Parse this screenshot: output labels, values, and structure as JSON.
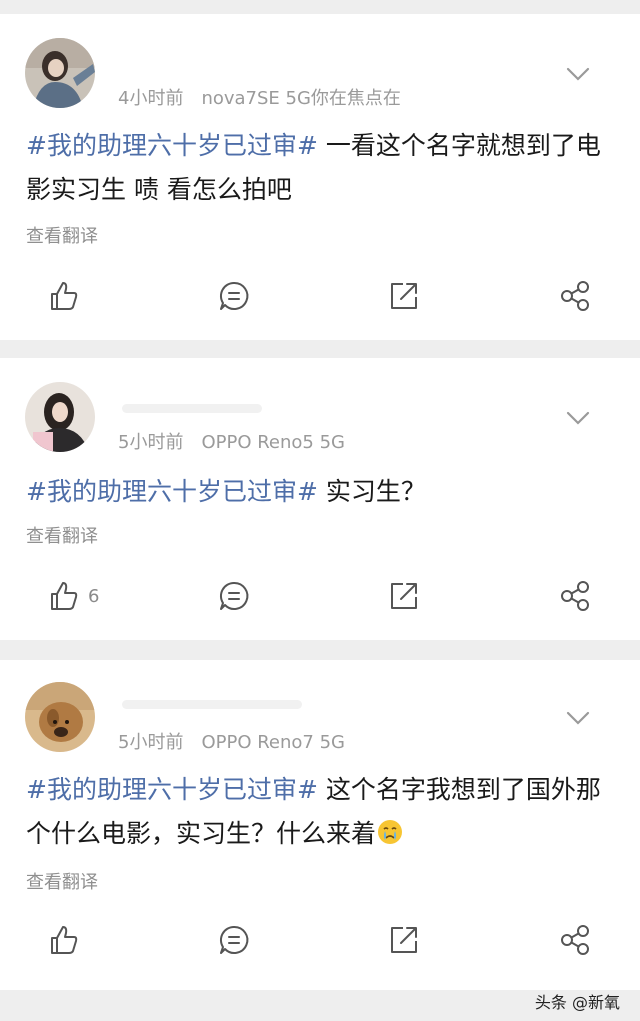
{
  "posts": [
    {
      "time": "4小时前",
      "source": "nova7SE 5G你在焦点在",
      "hashtag": "#我的助理六十岁已过审#",
      "body": " 一看这个名字就想到了电影实习生 啧 看怎么拍吧",
      "translate": "查看翻译",
      "likes": ""
    },
    {
      "time": "5小时前",
      "source": "OPPO Reno5 5G",
      "hashtag": "#我的助理六十岁已过审#",
      "body": " 实习生？",
      "translate": "查看翻译",
      "likes": "6"
    },
    {
      "time": "5小时前",
      "source": "OPPO Reno7 5G",
      "hashtag": "#我的助理六十岁已过审#",
      "body": " 这个名字我想到了国外那个什么电影，实习生？什么来着",
      "emoji": "crying-face-emoji",
      "translate": "查看翻译",
      "likes": ""
    }
  ],
  "icons": [
    "chevron-down-icon",
    "thumbs-up-icon",
    "comment-icon",
    "repost-icon",
    "share-icon"
  ],
  "watermark": "头条 @新氧",
  "colors": {
    "hashtag": "#4e6ea8",
    "meta": "#9a9a9a",
    "separator": "#eeeeee"
  }
}
